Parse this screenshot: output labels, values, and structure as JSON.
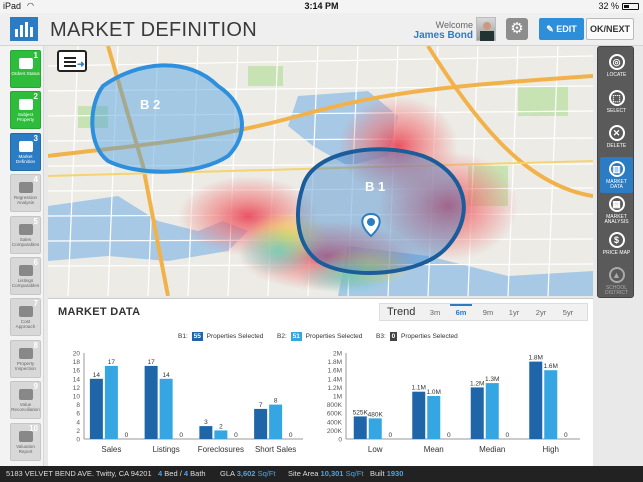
{
  "status": {
    "device": "iPad",
    "wifi": "wifi",
    "time": "3:14 PM",
    "battery": "32 %"
  },
  "header": {
    "title": "MARKET DEFINITION",
    "welcome": "Welcome",
    "user": "James Bond",
    "edit_label": "EDIT",
    "next_label": "OK/NEXT"
  },
  "steps": [
    {
      "num": "1",
      "label": "Orders Status",
      "state": "done",
      "icon": "list-icon"
    },
    {
      "num": "2",
      "label": "Subject Property",
      "state": "done",
      "icon": "house-icon"
    },
    {
      "num": "3",
      "label": "Market Definition",
      "state": "active",
      "icon": "group-icon"
    },
    {
      "num": "4",
      "label": "Regression Analysis",
      "state": "todo",
      "icon": "bar-chart-icon"
    },
    {
      "num": "5",
      "label": "Sales Comparables",
      "state": "todo",
      "icon": "houses-icon"
    },
    {
      "num": "6",
      "label": "Listings Comparables",
      "state": "todo",
      "icon": "houses-icon"
    },
    {
      "num": "7",
      "label": "Cost Approach",
      "state": "todo",
      "icon": "building-icon"
    },
    {
      "num": "8",
      "label": "Property Inspection",
      "state": "todo",
      "icon": "inspect-icon"
    },
    {
      "num": "9",
      "label": "Value Reconciliation",
      "state": "todo",
      "icon": "value-icon"
    },
    {
      "num": "10",
      "label": "Valuation Report",
      "state": "todo",
      "icon": "report-icon"
    }
  ],
  "map": {
    "areas": [
      {
        "label": "B 2"
      },
      {
        "label": "B 1"
      }
    ]
  },
  "tools": [
    {
      "label": "LOCATE",
      "glyph": "◎",
      "state": "normal"
    },
    {
      "label": "SELECT",
      "glyph": "⬚",
      "state": "normal"
    },
    {
      "label": "DELETE",
      "glyph": "✕",
      "state": "normal"
    },
    {
      "label": "MARKET DATA",
      "glyph": "▥",
      "state": "on"
    },
    {
      "label": "MARKET ANALYSIS",
      "glyph": "▦",
      "state": "normal"
    },
    {
      "label": "PRICE MAP",
      "glyph": "$",
      "state": "normal"
    },
    {
      "label": "SCHOOL DISTRICT",
      "glyph": "▲",
      "state": "dim"
    }
  ],
  "market": {
    "title": "MARKET DATA",
    "trend_label": "Trend",
    "trend_tabs": [
      "3m",
      "6m",
      "9m",
      "1yr",
      "2yr",
      "5yr"
    ],
    "trend_selected": "6m",
    "selections": [
      {
        "key": "B1:",
        "count": "55",
        "suffix": "Properties Selected",
        "color": "#1f66a8"
      },
      {
        "key": "B2:",
        "count": "51",
        "suffix": "Properties Selected",
        "color": "#36a6e2"
      },
      {
        "key": "B3:",
        "count": "0",
        "suffix": "Properties Selected",
        "color": "#444444"
      }
    ]
  },
  "chart_data": [
    {
      "type": "bar",
      "categories": [
        "Sales",
        "Listings",
        "Foreclosures",
        "Short Sales"
      ],
      "series": [
        {
          "name": "B1",
          "values": [
            14,
            17,
            3,
            7
          ],
          "labels": [
            "14",
            "17",
            "3",
            "7"
          ],
          "color": "#1f66a8"
        },
        {
          "name": "B2",
          "values": [
            17,
            14,
            2,
            8
          ],
          "labels": [
            "17",
            "14",
            "2",
            "8"
          ],
          "color": "#36a6e2"
        },
        {
          "name": "B3",
          "values": [
            0,
            0,
            0,
            0
          ],
          "labels": [
            "0",
            "0",
            "0",
            "0"
          ],
          "color": "#444444"
        }
      ],
      "yticks": [
        "0",
        "2",
        "4",
        "6",
        "8",
        "10",
        "12",
        "14",
        "16",
        "18",
        "20"
      ],
      "ylim": [
        0,
        20
      ]
    },
    {
      "type": "bar",
      "categories": [
        "Low",
        "Mean",
        "Median",
        "High"
      ],
      "series": [
        {
          "name": "B1",
          "values": [
            525000,
            1100000,
            1200000,
            1800000
          ],
          "labels": [
            "525K",
            "1.1M",
            "1.2M",
            "1.8M"
          ],
          "color": "#1f66a8"
        },
        {
          "name": "B2",
          "values": [
            480000,
            1000000,
            1300000,
            1600000
          ],
          "labels": [
            "480K",
            "1.0M",
            "1.3M",
            "1.6M"
          ],
          "color": "#36a6e2"
        },
        {
          "name": "B3",
          "values": [
            0,
            0,
            0,
            0
          ],
          "labels": [
            "0",
            "0",
            "0",
            "0"
          ],
          "color": "#444444"
        }
      ],
      "yticks": [
        "0",
        "200K",
        "400K",
        "600K",
        "800K",
        "1M",
        "1.2M",
        "1.4M",
        "1.6M",
        "1.8M",
        "2M"
      ],
      "ylim": [
        0,
        2000000
      ]
    }
  ],
  "footer": {
    "address": "5183 VELVET BEND AVE. Twitty, CA 94201",
    "bed": "4",
    "bed_label": "Bed /",
    "bath": "4",
    "bath_label": "Bath",
    "gla_label": "GLA",
    "gla": "3,602",
    "gla_unit": "Sq/Ft",
    "site_label": "Site Area",
    "site": "10,301",
    "site_unit": "Sq/Ft",
    "built_label": "Built",
    "built": "1930"
  }
}
